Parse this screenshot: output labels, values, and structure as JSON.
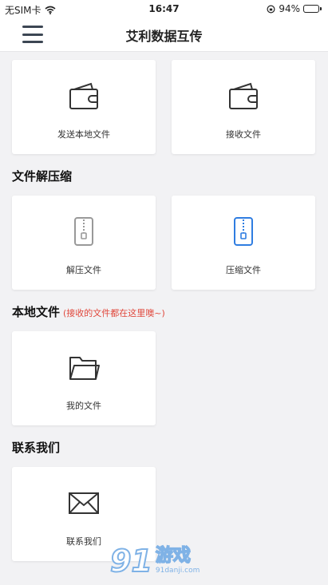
{
  "status_bar": {
    "carrier": "无SIM卡",
    "time": "16:47",
    "battery": "94%",
    "battery_level": 0.94
  },
  "nav": {
    "title": "艾利数据互传",
    "menu_icon": "hamburger-menu-icon"
  },
  "sections": {
    "transfer": {
      "cards": [
        {
          "label": "发送本地文件",
          "icon": "wallet-icon"
        },
        {
          "label": "接收文件",
          "icon": "wallet-icon"
        }
      ]
    },
    "compress": {
      "title": "文件解压缩",
      "cards": [
        {
          "label": "解压文件",
          "icon": "zip-file-icon"
        },
        {
          "label": "压缩文件",
          "icon": "zip-file-icon"
        }
      ]
    },
    "local": {
      "title": "本地文件",
      "note": "(接收的文件都在这里噢~)",
      "cards": [
        {
          "label": "我的文件",
          "icon": "folder-icon"
        }
      ]
    },
    "contact": {
      "title": "联系我们",
      "cards": [
        {
          "label": "联系我们",
          "icon": "envelope-icon"
        }
      ]
    }
  },
  "watermark": {
    "number": "91",
    "text": "游戏",
    "url": "91danji.com"
  },
  "colors": {
    "accent_blue": "#2f7de1",
    "note_red": "#e0473b",
    "icon_dark": "#333333",
    "background": "#f2f2f4"
  }
}
